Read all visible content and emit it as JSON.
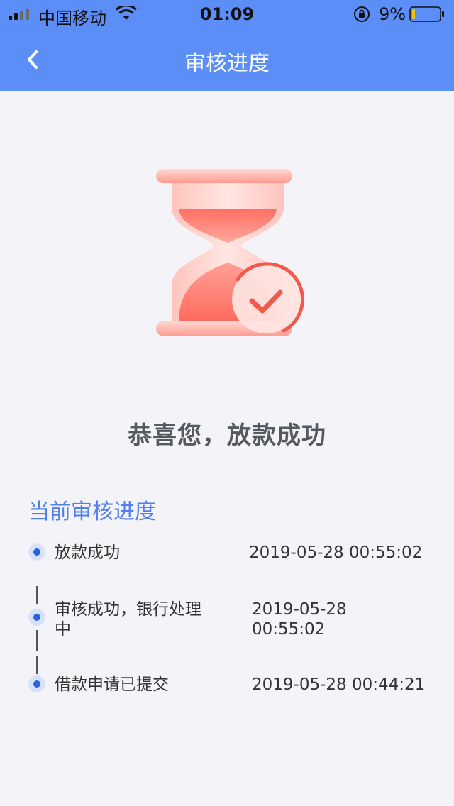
{
  "status_bar": {
    "carrier": "中国移动",
    "time": "01:09",
    "battery": "9%",
    "battery_level": 0.09
  },
  "nav": {
    "title": "审核进度",
    "back_icon": "chevron-left-icon"
  },
  "illustration": {
    "icon": "hourglass-check-icon",
    "colors": {
      "primary": "#ff6b5e",
      "light": "#ffd0cb"
    }
  },
  "result": {
    "title": "恭喜您，放款成功"
  },
  "progress": {
    "title": "当前审核进度",
    "steps": [
      {
        "label": "放款成功",
        "time": "2019-05-28 00:55:02"
      },
      {
        "label_line1": "审核成功，银行处理",
        "label_line2": "中",
        "time_line1": "2019-05-28",
        "time_line2": "00:55:02"
      },
      {
        "label": "借款申请已提交",
        "time": "2019-05-28 00:44:21"
      }
    ]
  },
  "colors": {
    "header": "#5b8ef7",
    "accent": "#4f7ff0",
    "dot": "#2a63e0",
    "background": "#f4f4f8"
  }
}
